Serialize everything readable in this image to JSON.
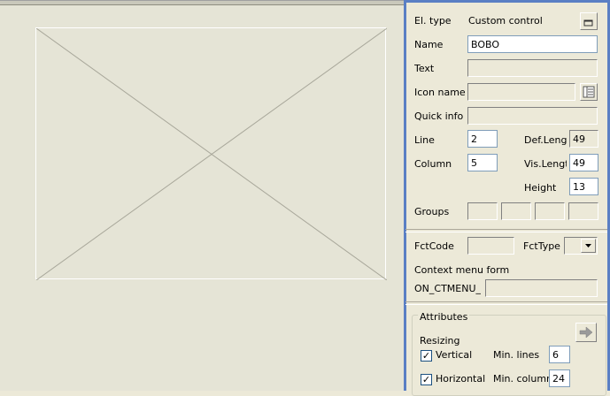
{
  "properties": {
    "el_type_label": "El. type",
    "el_type_value": "Custom control",
    "name_label": "Name",
    "name_value": "BOBO",
    "text_label": "Text",
    "text_value": "",
    "icon_name_label": "Icon name",
    "icon_name_value": "",
    "quick_info_label": "Quick info",
    "quick_info_value": "",
    "line_label": "Line",
    "line_value": "2",
    "column_label": "Column",
    "column_value": "5",
    "def_length_label": "Def.Lengt",
    "def_length_value": "49",
    "vis_length_label": "Vis.Length",
    "vis_length_value": "49",
    "height_label": "Height",
    "height_value": "13",
    "groups_label": "Groups",
    "fctcode_label": "FctCode",
    "fctcode_value": "",
    "fcttype_label": "FctType",
    "fcttype_value": "",
    "context_menu_label": "Context menu form",
    "context_menu_prefix": "ON_CTMENU_",
    "context_menu_value": ""
  },
  "attributes": {
    "title": "Attributes",
    "resizing_label": "Resizing",
    "vertical_label": "Vertical",
    "vertical_checked": true,
    "horizontal_label": "Horizontal",
    "horizontal_checked": true,
    "min_lines_label": "Min. lines",
    "min_lines_value": "6",
    "min_columns_label": "Min. columns",
    "min_columns_value": "24"
  },
  "icons": {
    "el_type_button": "small-window-icon",
    "icon_picker": "list-icon",
    "arrow_button": "arrow-right-icon",
    "dropdown": "chevron-down-icon"
  }
}
